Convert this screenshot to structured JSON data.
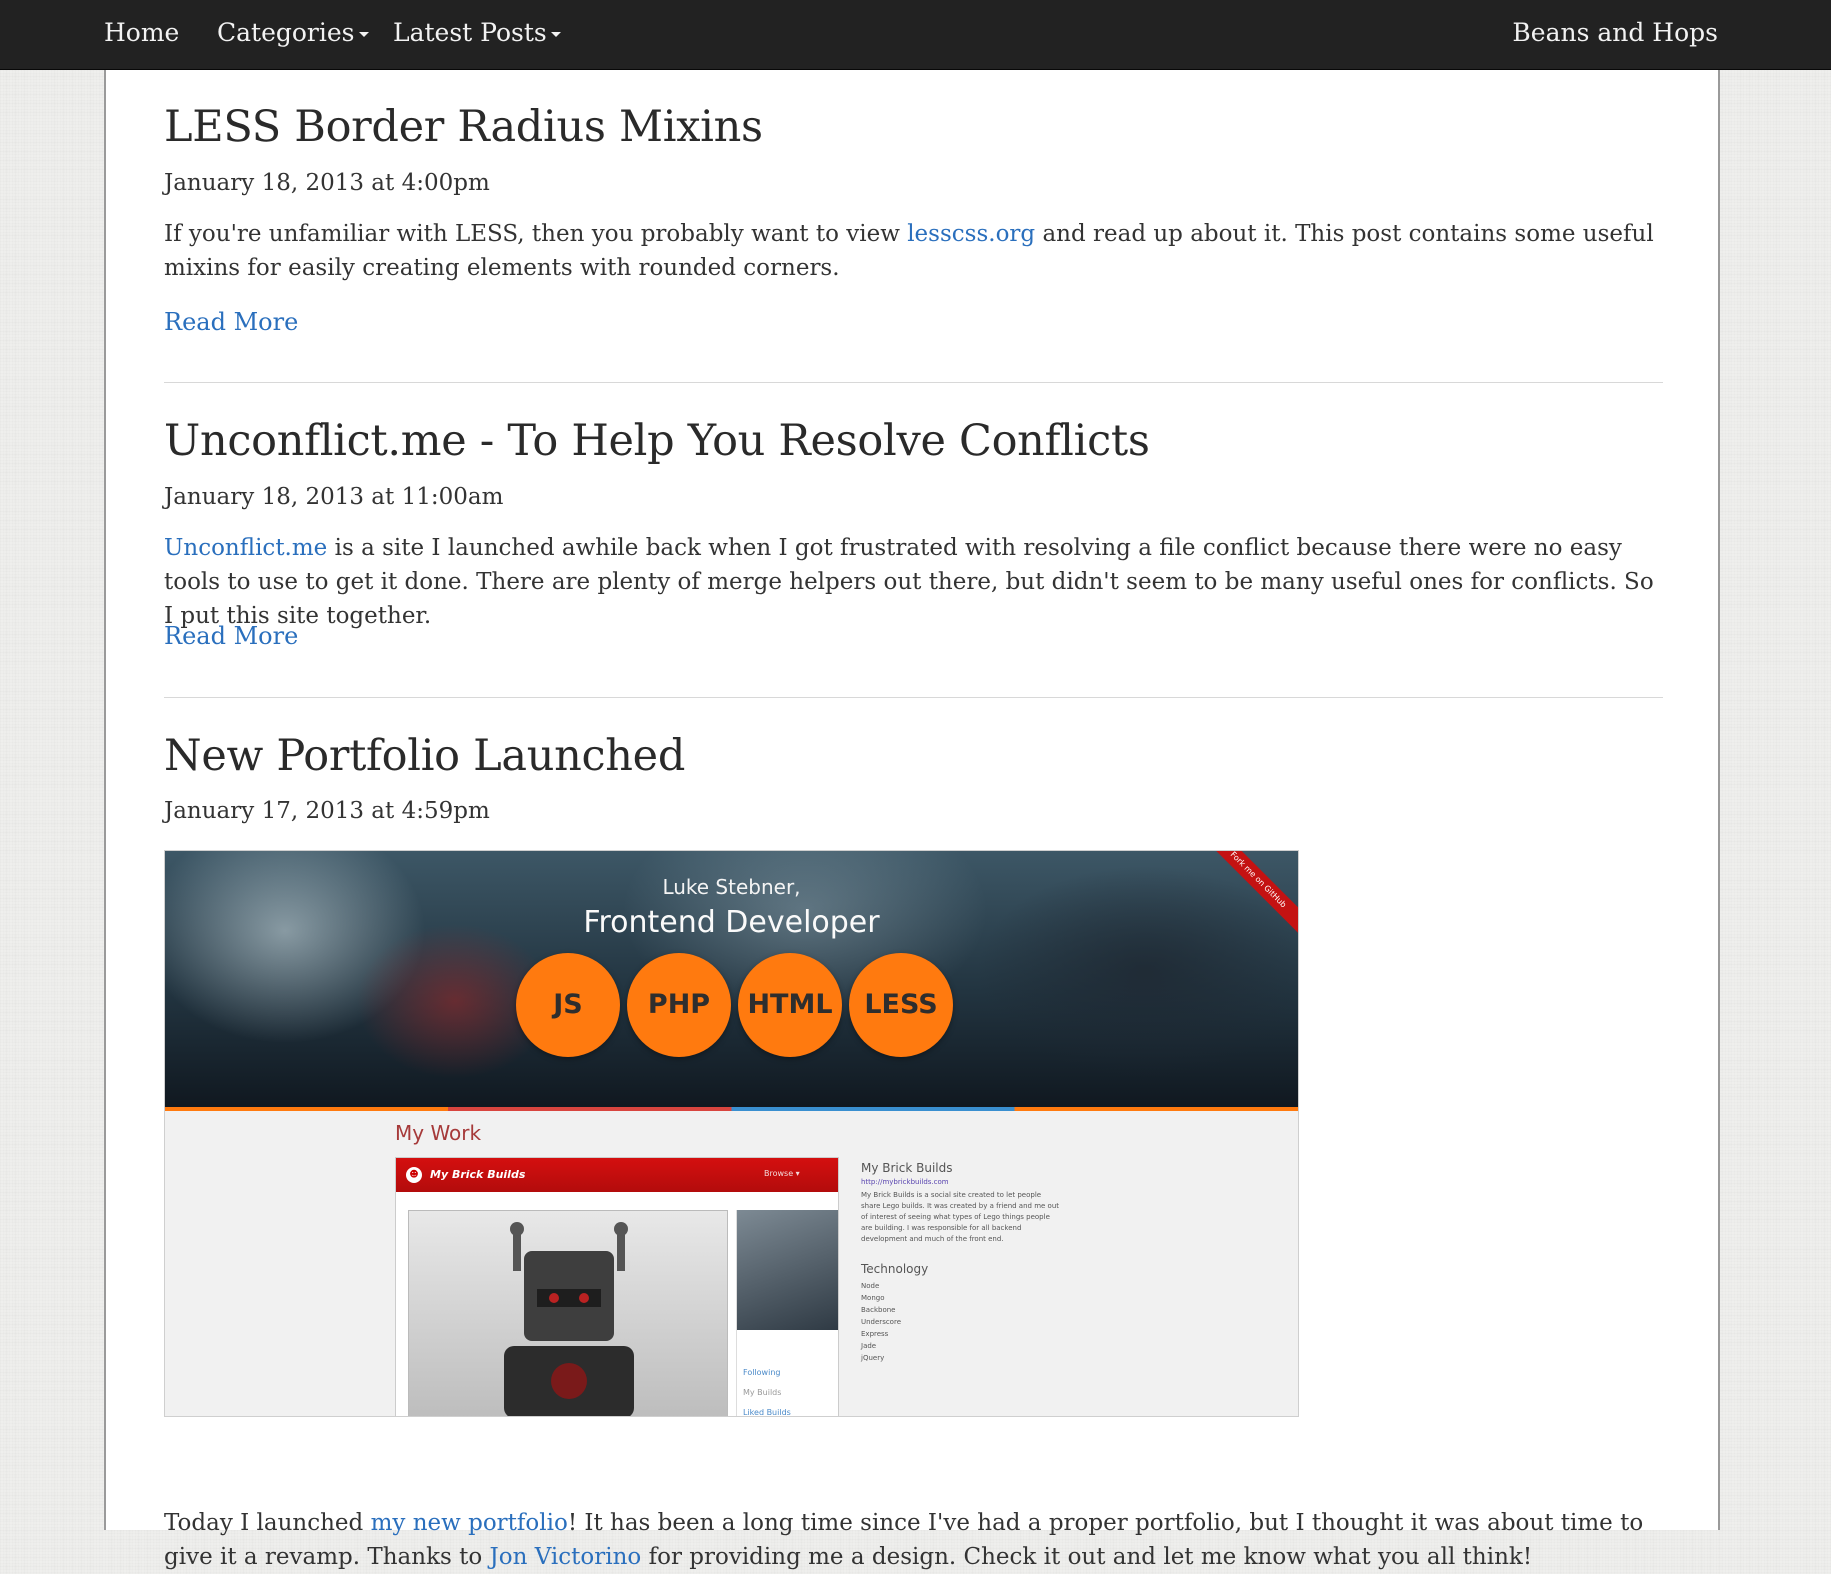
{
  "nav": {
    "home": "Home",
    "categories": "Categories",
    "latest_posts": "Latest Posts",
    "brand": "Beans and Hops"
  },
  "posts": [
    {
      "title": "LESS Border Radius Mixins",
      "date": "January 18, 2013 at 4:00pm",
      "body_before": "If you're unfamiliar with LESS, then you probably want to view ",
      "link": "lesscss.org",
      "body_after": " and read up about it. This post contains some useful mixins for easily creating elements with rounded corners.",
      "read_more": "Read More"
    },
    {
      "title": "Unconflict.me - To Help You Resolve Conflicts",
      "date": "January 18, 2013 at 11:00am",
      "link": "Unconflict.me",
      "body_after": " is a site I launched awhile back when I got frustrated with resolving a file conflict because there were no easy tools to use to get it done. There are plenty of merge helpers out there, but didn't seem to be many useful ones for conflicts. So I put this site together.",
      "read_more": "Read More"
    },
    {
      "title": "New Portfolio Launched",
      "date": "January 17, 2013 at 4:59pm",
      "body_before": "Today I launched ",
      "link1": "my new portfolio",
      "body_middle": "! It has been a long time since I've had a proper portfolio, but I thought it was about time to give it a revamp. Thanks to ",
      "link2": "Jon Victorino",
      "body_after": " for providing me a design. Check it out and let me know what you all think!"
    }
  ],
  "screenshot": {
    "name": "Luke Stebner,",
    "role": "Frontend Developer",
    "skills": [
      "JS",
      "PHP",
      "HTML",
      "LESS"
    ],
    "ribbon": "Fork me on GitHub",
    "section": "My Work",
    "app_title": "My Brick Builds",
    "app_browse": "Browse ▾",
    "side_links": [
      "Following",
      "My Builds",
      "Liked Builds"
    ],
    "detail_title": "My Brick Builds",
    "detail_url": "http://mybrickbuilds.com",
    "detail_desc": "My Brick Builds is a social site created to let people share Lego builds. It was created by a friend and me out of interest of seeing what types of Lego things people are building. I was responsible for all backend development and much of the front end.",
    "tech_title": "Technology",
    "tech": [
      "Node",
      "Mongo",
      "Backbone",
      "Underscore",
      "Express",
      "Jade",
      "jQuery"
    ]
  },
  "colors": {
    "navbar": "#222222",
    "link": "#2a6fbd",
    "accent": "#ff7a0f"
  }
}
